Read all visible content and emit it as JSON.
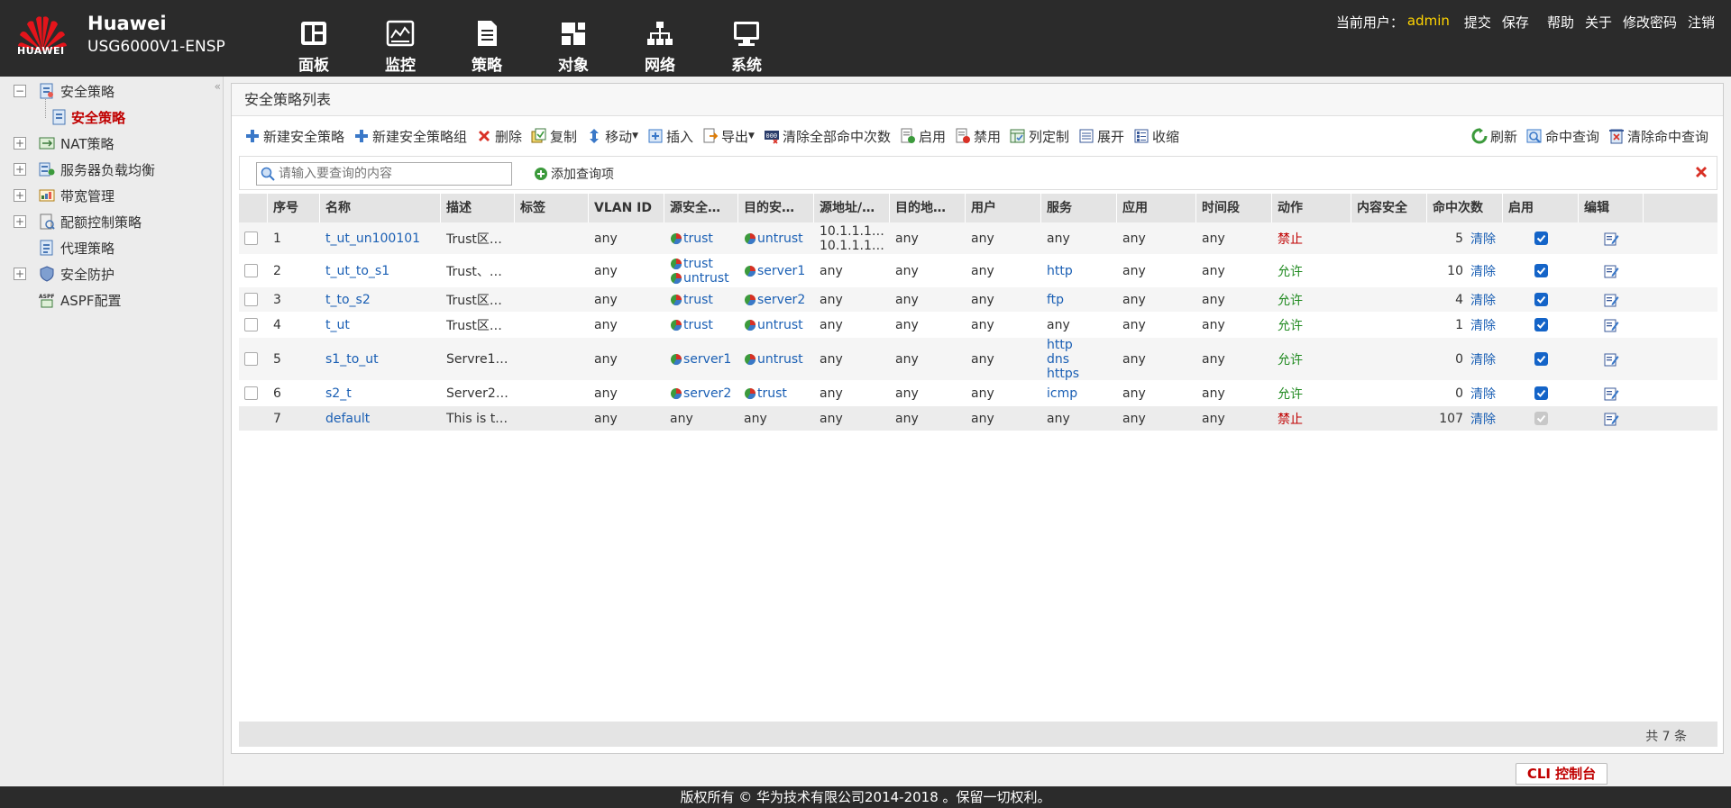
{
  "header": {
    "logo_text": "HUAWEI",
    "brand": "Huawei",
    "model": "USG6000V1-ENSP",
    "nav": [
      {
        "label": "面板",
        "icon": "dashboard-icon"
      },
      {
        "label": "监控",
        "icon": "monitor-icon"
      },
      {
        "label": "策略",
        "icon": "policy-icon"
      },
      {
        "label": "对象",
        "icon": "object-icon"
      },
      {
        "label": "网络",
        "icon": "network-icon"
      },
      {
        "label": "系统",
        "icon": "system-icon"
      }
    ],
    "user_label": "当前用户：",
    "user_name": "admin",
    "links": [
      "提交",
      "保存",
      "帮助",
      "关于",
      "修改密码",
      "注销"
    ]
  },
  "sidebar": {
    "items": [
      {
        "label": "安全策略"
      },
      {
        "label": "安全策略"
      },
      {
        "label": "NAT策略"
      },
      {
        "label": "服务器负载均衡"
      },
      {
        "label": "带宽管理"
      },
      {
        "label": "配额控制策略"
      },
      {
        "label": "代理策略"
      },
      {
        "label": "安全防护"
      },
      {
        "label": "ASPF配置"
      }
    ]
  },
  "panel": {
    "title": "安全策略列表"
  },
  "toolbar": {
    "left": [
      "新建安全策略",
      "新建安全策略组",
      "删除",
      "复制",
      "移动",
      "插入",
      "导出",
      "清除全部命中次数",
      "启用",
      "禁用",
      "列定制",
      "展开",
      "收缩"
    ],
    "right": [
      "刷新",
      "命中查询",
      "清除命中查询"
    ]
  },
  "search": {
    "placeholder": "请输入要查询的内容",
    "add_query": "添加查询项"
  },
  "table": {
    "headers": [
      "",
      "序号",
      "名称",
      "描述",
      "标签",
      "VLAN ID",
      "源安全…",
      "目的安…",
      "源地址/…",
      "目的地…",
      "用户",
      "服务",
      "应用",
      "时间段",
      "动作",
      "内容安全",
      "命中次数",
      "启用",
      "编辑"
    ],
    "rows": [
      {
        "no": "1",
        "name": "t_ut_un100101",
        "desc": "Trust区…",
        "vlan": "any",
        "src_zone": [
          "trust"
        ],
        "dst_zone": [
          "untrust"
        ],
        "src_addr": [
          "10.1.1.1…",
          "10.1.1.1…"
        ],
        "dst_addr": "any",
        "user": "any",
        "service": [
          "any"
        ],
        "app": "any",
        "time": "any",
        "action": "禁止",
        "hits": "5",
        "clear": "清除",
        "enabled": true
      },
      {
        "no": "2",
        "name": "t_ut_to_s1",
        "desc": "Trust、…",
        "vlan": "any",
        "src_zone": [
          "trust",
          "untrust"
        ],
        "dst_zone": [
          "server1"
        ],
        "src_addr": [
          "any"
        ],
        "dst_addr": "any",
        "user": "any",
        "service": [
          "http"
        ],
        "app": "any",
        "time": "any",
        "action": "允许",
        "hits": "10",
        "clear": "清除",
        "enabled": true
      },
      {
        "no": "3",
        "name": "t_to_s2",
        "desc": "Trust区…",
        "vlan": "any",
        "src_zone": [
          "trust"
        ],
        "dst_zone": [
          "server2"
        ],
        "src_addr": [
          "any"
        ],
        "dst_addr": "any",
        "user": "any",
        "service": [
          "ftp"
        ],
        "app": "any",
        "time": "any",
        "action": "允许",
        "hits": "4",
        "clear": "清除",
        "enabled": true
      },
      {
        "no": "4",
        "name": "t_ut",
        "desc": "Trust区…",
        "vlan": "any",
        "src_zone": [
          "trust"
        ],
        "dst_zone": [
          "untrust"
        ],
        "src_addr": [
          "any"
        ],
        "dst_addr": "any",
        "user": "any",
        "service": [
          "any"
        ],
        "app": "any",
        "time": "any",
        "action": "允许",
        "hits": "1",
        "clear": "清除",
        "enabled": true
      },
      {
        "no": "5",
        "name": "s1_to_ut",
        "desc": "Servre1…",
        "vlan": "any",
        "src_zone": [
          "server1"
        ],
        "dst_zone": [
          "untrust"
        ],
        "src_addr": [
          "any"
        ],
        "dst_addr": "any",
        "user": "any",
        "service": [
          "http",
          "dns",
          "https"
        ],
        "app": "any",
        "time": "any",
        "action": "允许",
        "hits": "0",
        "clear": "清除",
        "enabled": true
      },
      {
        "no": "6",
        "name": "s2_t",
        "desc": "Server2…",
        "vlan": "any",
        "src_zone": [
          "server2"
        ],
        "dst_zone": [
          "trust"
        ],
        "src_addr": [
          "any"
        ],
        "dst_addr": "any",
        "user": "any",
        "service": [
          "icmp"
        ],
        "app": "any",
        "time": "any",
        "action": "允许",
        "hits": "0",
        "clear": "清除",
        "enabled": true
      },
      {
        "no": "7",
        "name": "default",
        "desc": "This is t…",
        "vlan": "any",
        "src_zone": [
          "any"
        ],
        "dst_zone": [
          "any"
        ],
        "src_addr": [
          "any"
        ],
        "dst_addr": "any",
        "user": "any",
        "service": [
          "any"
        ],
        "app": "any",
        "time": "any",
        "action": "禁止",
        "hits": "107",
        "clear": "清除",
        "enabled": true,
        "locked": true
      }
    ],
    "total": "共 7 条"
  },
  "cli_button": "CLI 控制台",
  "copyright": "版权所有 © 华为技术有限公司2014-2018 。保留一切权利。",
  "colors": {
    "header_bg": "#2b2b2b",
    "user_name": "#ffd400",
    "deny": "#c00000",
    "allow": "#228b22",
    "link": "#1a5fb4",
    "checkbox_on": "#1464c8"
  }
}
